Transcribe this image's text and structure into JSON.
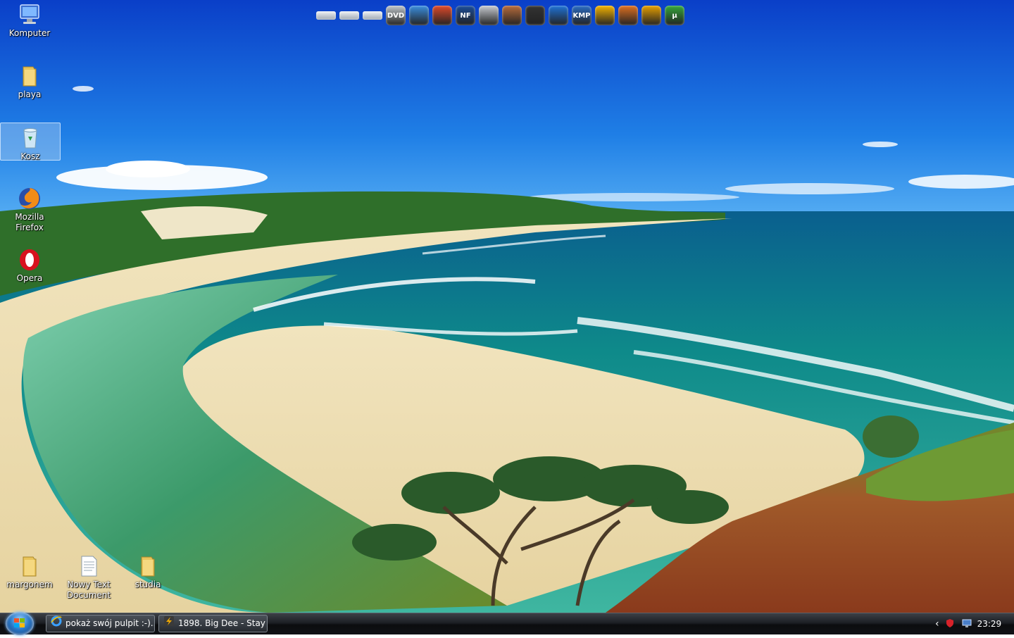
{
  "desktop": {
    "icons": [
      {
        "label": "Komputer",
        "icon": "computer-icon"
      },
      {
        "label": "playa",
        "icon": "folder-icon"
      },
      {
        "label": "Kosz",
        "icon": "recycle-bin-icon"
      },
      {
        "label": "Mozilla Firefox",
        "icon": "firefox-icon"
      },
      {
        "label": "Opera",
        "icon": "opera-icon"
      }
    ],
    "bottom_icons": [
      {
        "label": "margonem",
        "icon": "folder-icon"
      },
      {
        "label": "Nowy Text Document",
        "icon": "text-document-icon"
      },
      {
        "label": "studia",
        "icon": "folder-icon"
      }
    ]
  },
  "dock": {
    "apps": [
      {
        "name": "drive-icon",
        "color": "#cfd6dc"
      },
      {
        "name": "drive-icon",
        "color": "#cfd6dc"
      },
      {
        "name": "drive-icon",
        "color": "#cfd6dc"
      },
      {
        "name": "dvd-drive-icon",
        "color": "#bfc6cc",
        "text": "DVD"
      },
      {
        "name": "edit-tool-icon",
        "color": "#3b8fe0"
      },
      {
        "name": "ccleaner-icon",
        "color": "#e04a2a"
      },
      {
        "name": "media-app-icon",
        "color": "#1b4d9a",
        "text": "NF"
      },
      {
        "name": "disc-icon",
        "color": "#c8ccd2"
      },
      {
        "name": "game-icon",
        "color": "#b86c3c"
      },
      {
        "name": "game-icon",
        "color": "#333333"
      },
      {
        "name": "daemon-tools-icon",
        "color": "#1f73d8"
      },
      {
        "name": "kmplayer-icon",
        "color": "#2a6cc4",
        "text": "KMP"
      },
      {
        "name": "gadu-gadu-icon",
        "color": "#f5b400"
      },
      {
        "name": "media-app-icon",
        "color": "#e07020"
      },
      {
        "name": "winamp-icon",
        "color": "#e8a000"
      },
      {
        "name": "utorrent-icon",
        "color": "#35a83a",
        "text": "µ"
      }
    ]
  },
  "taskbar": {
    "tasks": [
      {
        "label": "pokaż swój pulpit :-)...",
        "icon": "ie-icon"
      },
      {
        "label": "1898. Big Dee - Stay ...",
        "icon": "winamp-icon"
      }
    ],
    "tray": {
      "arrow": "‹",
      "clock": "23:29"
    }
  }
}
